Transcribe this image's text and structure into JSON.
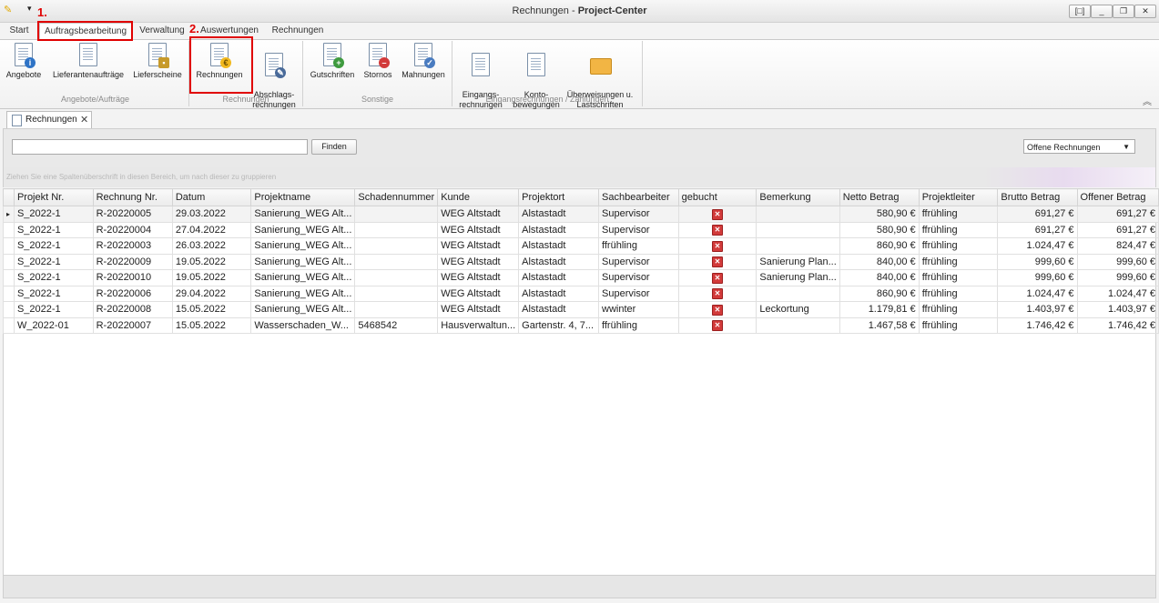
{
  "window": {
    "title_prefix": "Rechnungen -",
    "title_app": "Project-Center",
    "controls": [
      "[□]",
      "_",
      "❐",
      "✕"
    ]
  },
  "annotations": {
    "step1": "1.",
    "step2": "2."
  },
  "ribbon_tabs": [
    "Start",
    "Auftragsbearbeitung",
    "Verwaltung",
    "Auswertungen",
    "Rechnungen"
  ],
  "ribbon": {
    "buttons": [
      {
        "label": "Angebote"
      },
      {
        "label": "Lieferantenaufträge"
      },
      {
        "label": "Lieferscheine"
      },
      {
        "label": "Rechnungen"
      },
      {
        "label": "Abschlags-\nrechnungen"
      },
      {
        "label": "Gutschriften"
      },
      {
        "label": "Stornos"
      },
      {
        "label": "Mahnungen"
      },
      {
        "label": "Eingangs-\nrechnungen"
      },
      {
        "label": "Konto-\nbewegungen"
      },
      {
        "label": "Überweisungen u.\nLastschriften"
      }
    ],
    "groups": [
      "Angebote/Aufträge",
      "Rechnungen",
      "Sonstige",
      "Eingangsrechnungen / Zahlungen"
    ]
  },
  "doc_tab": {
    "label": "Rechnungen"
  },
  "search": {
    "value": "",
    "find_label": "Finden",
    "filter_value": "Offene Rechnungen"
  },
  "group_hint": "Ziehen Sie eine Spaltenüberschrift in diesen Bereich, um nach dieser zu gruppieren",
  "grid": {
    "columns": [
      "Projekt Nr.",
      "Rechnung Nr.",
      "Datum",
      "Projektname",
      "Schadennummer",
      "Kunde",
      "Projektort",
      "Sachbearbeiter",
      "gebucht",
      "Bemerkung",
      "Netto Betrag",
      "Projektleiter",
      "Brutto Betrag",
      "Offener Betrag"
    ],
    "rows": [
      [
        "S_2022-1",
        "R-20220005",
        "29.03.2022",
        "Sanierung_WEG Alt...",
        "",
        "WEG Altstadt",
        "Alstastadt",
        "Supervisor",
        "false",
        "",
        "580,90 €",
        "ffrühling",
        "691,27 €",
        "691,27 €"
      ],
      [
        "S_2022-1",
        "R-20220004",
        "27.04.2022",
        "Sanierung_WEG Alt...",
        "",
        "WEG Altstadt",
        "Alstastadt",
        "Supervisor",
        "false",
        "",
        "580,90 €",
        "ffrühling",
        "691,27 €",
        "691,27 €"
      ],
      [
        "S_2022-1",
        "R-20220003",
        "26.03.2022",
        "Sanierung_WEG Alt...",
        "",
        "WEG Altstadt",
        "Alstastadt",
        "ffrühling",
        "false",
        "",
        "860,90 €",
        "ffrühling",
        "1.024,47 €",
        "824,47 €"
      ],
      [
        "S_2022-1",
        "R-20220009",
        "19.05.2022",
        "Sanierung_WEG Alt...",
        "",
        "WEG Altstadt",
        "Alstastadt",
        "Supervisor",
        "false",
        "Sanierung Plan...",
        "840,00 €",
        "ffrühling",
        "999,60 €",
        "999,60 €"
      ],
      [
        "S_2022-1",
        "R-20220010",
        "19.05.2022",
        "Sanierung_WEG Alt...",
        "",
        "WEG Altstadt",
        "Alstastadt",
        "Supervisor",
        "false",
        "Sanierung Plan...",
        "840,00 €",
        "ffrühling",
        "999,60 €",
        "999,60 €"
      ],
      [
        "S_2022-1",
        "R-20220006",
        "29.04.2022",
        "Sanierung_WEG Alt...",
        "",
        "WEG Altstadt",
        "Alstastadt",
        "Supervisor",
        "false",
        "",
        "860,90 €",
        "ffrühling",
        "1.024,47 €",
        "1.024,47 €"
      ],
      [
        "S_2022-1",
        "R-20220008",
        "15.05.2022",
        "Sanierung_WEG Alt...",
        "",
        "WEG Altstadt",
        "Alstastadt",
        "wwinter",
        "false",
        "Leckortung",
        "1.179,81 €",
        "ffrühling",
        "1.403,97 €",
        "1.403,97 €"
      ],
      [
        "W_2022-01",
        "R-20220007",
        "15.05.2022",
        "Wasserschaden_W...",
        "5468542",
        "Hausverwaltun...",
        "Gartenstr. 4, 7...",
        "ffrühling",
        "false",
        "",
        "1.467,58 €",
        "ffrühling",
        "1.746,42 €",
        "1.746,42 €"
      ]
    ]
  },
  "colors": {
    "highlight_red": "#e00000",
    "not_booked": "#d23a3a"
  }
}
